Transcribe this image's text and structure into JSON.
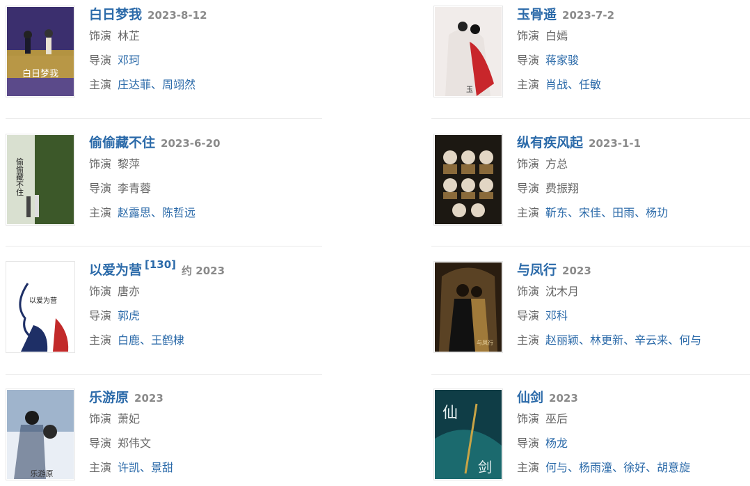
{
  "movies": [
    {
      "title": "白日梦我",
      "sup": "",
      "date": "2023-8-12",
      "role_label": "饰演",
      "role": "林芷",
      "director_label": "导演",
      "director": "邓珂",
      "cast_label": "主演",
      "cast": [
        "庄达菲",
        "周翊然"
      ]
    },
    {
      "title": "玉骨遥",
      "sup": "",
      "date": "2023-7-2",
      "role_label": "饰演",
      "role": "白嫣",
      "director_label": "导演",
      "director": "蒋家骏",
      "cast_label": "主演",
      "cast": [
        "肖战",
        "任敏"
      ]
    },
    {
      "title": "偷偷藏不住",
      "sup": "",
      "date": "2023-6-20",
      "role_label": "饰演",
      "role": "黎萍",
      "director_label": "导演",
      "director": "李青蓉",
      "cast_label": "主演",
      "cast": [
        "赵露思",
        "陈哲远"
      ]
    },
    {
      "title": "纵有疾风起",
      "sup": "",
      "date": "2023-1-1",
      "role_label": "饰演",
      "role": "方总",
      "director_label": "导演",
      "director": "费振翔",
      "cast_label": "主演",
      "cast": [
        "靳东",
        "宋佳",
        "田雨",
        "杨玏"
      ]
    },
    {
      "title": "以爱为营",
      "sup": "[130]",
      "date": "约 2023",
      "role_label": "饰演",
      "role": "唐亦",
      "director_label": "导演",
      "director": "郭虎",
      "cast_label": "主演",
      "cast": [
        "白鹿",
        "王鹤棣"
      ]
    },
    {
      "title": "与凤行",
      "sup": "",
      "date": "2023",
      "role_label": "饰演",
      "role": "沈木月",
      "director_label": "导演",
      "director": "邓科",
      "cast_label": "主演",
      "cast": [
        "赵丽颖",
        "林更新",
        "辛云来",
        "何与"
      ]
    },
    {
      "title": "乐游原",
      "sup": "",
      "date": "2023",
      "role_label": "饰演",
      "role": "萧妃",
      "director_label": "导演",
      "director": "郑伟文",
      "cast_label": "主演",
      "cast": [
        "许凯",
        "景甜"
      ]
    },
    {
      "title": "仙剑",
      "sup": "",
      "date": "2023",
      "role_label": "饰演",
      "role": "巫后",
      "director_label": "导演",
      "director": "杨龙",
      "cast_label": "主演",
      "cast": [
        "何与",
        "杨雨潼",
        "徐好",
        "胡意旋"
      ]
    }
  ],
  "posters": [
    {
      "icon": "poster-bairimengwo",
      "text": "白日梦我",
      "colors": [
        "#3b2f6e",
        "#c9a43a",
        "#5b4a8a"
      ]
    },
    {
      "icon": "poster-yuguyao",
      "text": "玉",
      "colors": [
        "#f1ecea",
        "#c8262b",
        "#e9e3e0"
      ]
    },
    {
      "icon": "poster-toutoucangbuzhu",
      "text": "偷偷藏不住",
      "colors": [
        "#5f7a3a",
        "#2e4a22",
        "#d9e0d0"
      ]
    },
    {
      "icon": "poster-zongyoujifengqi",
      "text": "",
      "colors": [
        "#1c1812",
        "#8a6a3a",
        "#e2d6c4"
      ]
    },
    {
      "icon": "poster-yiaiweiying",
      "text": "以爱为营",
      "colors": [
        "#ffffff",
        "#1e2f66",
        "#c22a2a"
      ]
    },
    {
      "icon": "poster-yufengxing",
      "text": "与凤行",
      "colors": [
        "#2a1d10",
        "#a07a3a",
        "#5a4224"
      ]
    },
    {
      "icon": "poster-leyouyuan",
      "text": "乐游原",
      "colors": [
        "#9fb4cc",
        "#e9eef5",
        "#3a4d6a"
      ]
    },
    {
      "icon": "poster-xianjian",
      "text": "仙剑",
      "colors": [
        "#0f3d46",
        "#1b6a6e",
        "#c9a446"
      ]
    }
  ],
  "colors": {
    "link": "#2b6aa9",
    "date": "#8a8a8a",
    "label": "#666666",
    "divider": "#e8e8e8"
  }
}
